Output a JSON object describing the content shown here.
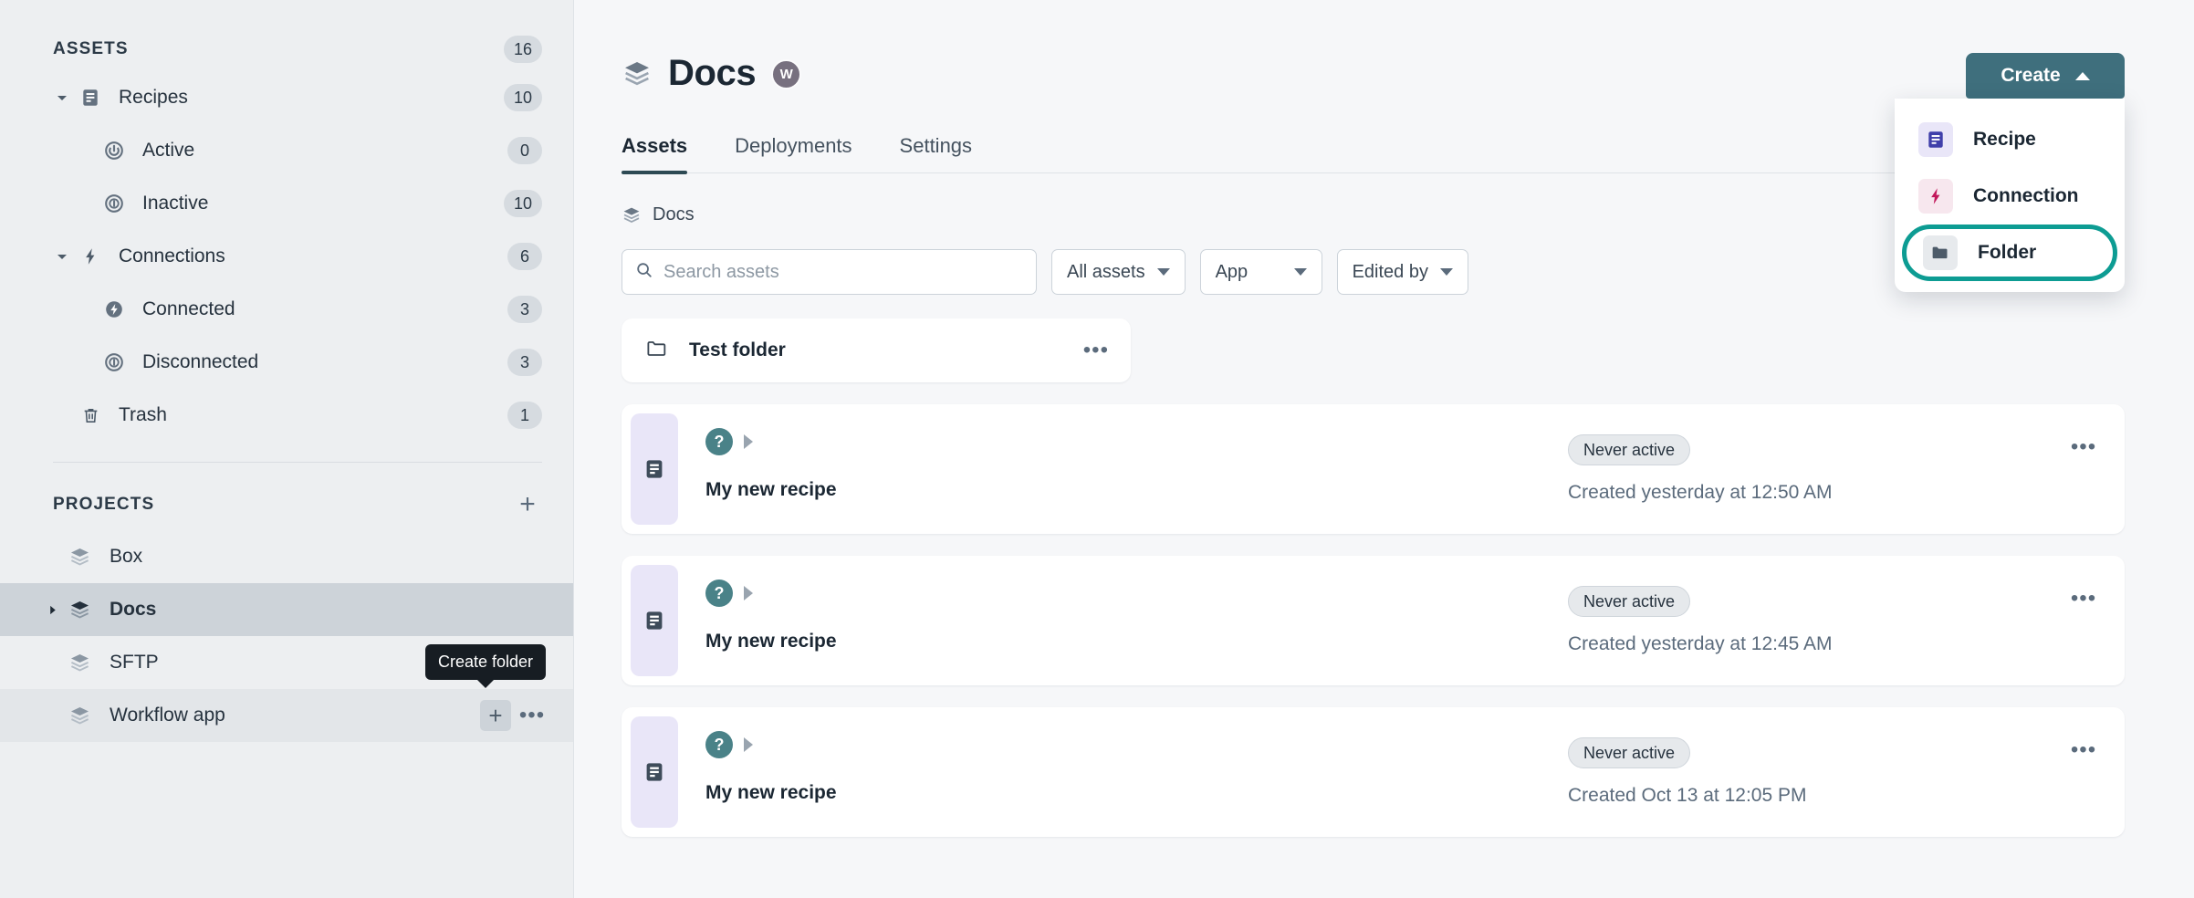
{
  "sidebar": {
    "assets": {
      "title": "ASSETS",
      "count": "16",
      "items": [
        {
          "label": "Recipes",
          "count": "10",
          "icon": "recipe-icon",
          "level": 0,
          "caret": "down"
        },
        {
          "label": "Active",
          "count": "0",
          "icon": "power-icon",
          "level": 1,
          "caret": "none"
        },
        {
          "label": "Inactive",
          "count": "10",
          "icon": "inactive-icon",
          "level": 1,
          "caret": "none"
        },
        {
          "label": "Connections",
          "count": "6",
          "icon": "lightning-icon",
          "level": 0,
          "caret": "down"
        },
        {
          "label": "Connected",
          "count": "3",
          "icon": "connected-icon",
          "level": 1,
          "caret": "none"
        },
        {
          "label": "Disconnected",
          "count": "3",
          "icon": "disconnected-icon",
          "level": 1,
          "caret": "none"
        },
        {
          "label": "Trash",
          "count": "1",
          "icon": "trash-icon",
          "level": 0,
          "caret": "none"
        }
      ]
    },
    "projects": {
      "title": "PROJECTS",
      "add_label": "+",
      "items": [
        {
          "label": "Box",
          "state": "normal",
          "caret": false
        },
        {
          "label": "Docs",
          "state": "selected",
          "caret": true
        },
        {
          "label": "SFTP",
          "state": "normal",
          "caret": false
        },
        {
          "label": "Workflow app",
          "state": "hovered",
          "caret": false
        }
      ]
    },
    "tooltip": "Create folder"
  },
  "header": {
    "title": "Docs",
    "avatar_initial": "W",
    "tabs": [
      {
        "label": "Assets",
        "active": true
      },
      {
        "label": "Deployments",
        "active": false
      },
      {
        "label": "Settings",
        "active": false
      }
    ],
    "breadcrumb": "Docs"
  },
  "create": {
    "button_label": "Create",
    "menu": [
      {
        "label": "Recipe",
        "icon": "recipe-icon",
        "highlighted": false
      },
      {
        "label": "Connection",
        "icon": "lightning-icon",
        "highlighted": false
      },
      {
        "label": "Folder",
        "icon": "folder-icon",
        "highlighted": true
      }
    ]
  },
  "toolbar": {
    "search_placeholder": "Search assets",
    "search_value": "",
    "filters": [
      {
        "label": "All assets"
      },
      {
        "label": "App"
      },
      {
        "label": "Edited by"
      }
    ]
  },
  "folder_row": {
    "name": "Test folder",
    "menu_label": "•••"
  },
  "assets": [
    {
      "title": "My new recipe",
      "status": "Never active",
      "created": "Created yesterday at 12:50 AM",
      "badge": "?"
    },
    {
      "title": "My new recipe",
      "status": "Never active",
      "created": "Created yesterday at 12:45 AM",
      "badge": "?"
    },
    {
      "title": "My new recipe",
      "status": "Never active",
      "created": "Created Oct 13 at 12:05 PM",
      "badge": "?"
    }
  ],
  "colors": {
    "accent_teal": "#3f6f7d",
    "highlight_ring": "#0d9c93",
    "sidebar_bg": "#edeff1",
    "canvas_bg": "#f6f7f9",
    "recipe_lavender": "#e9e6f8",
    "avatar_purple": "#77707f"
  }
}
